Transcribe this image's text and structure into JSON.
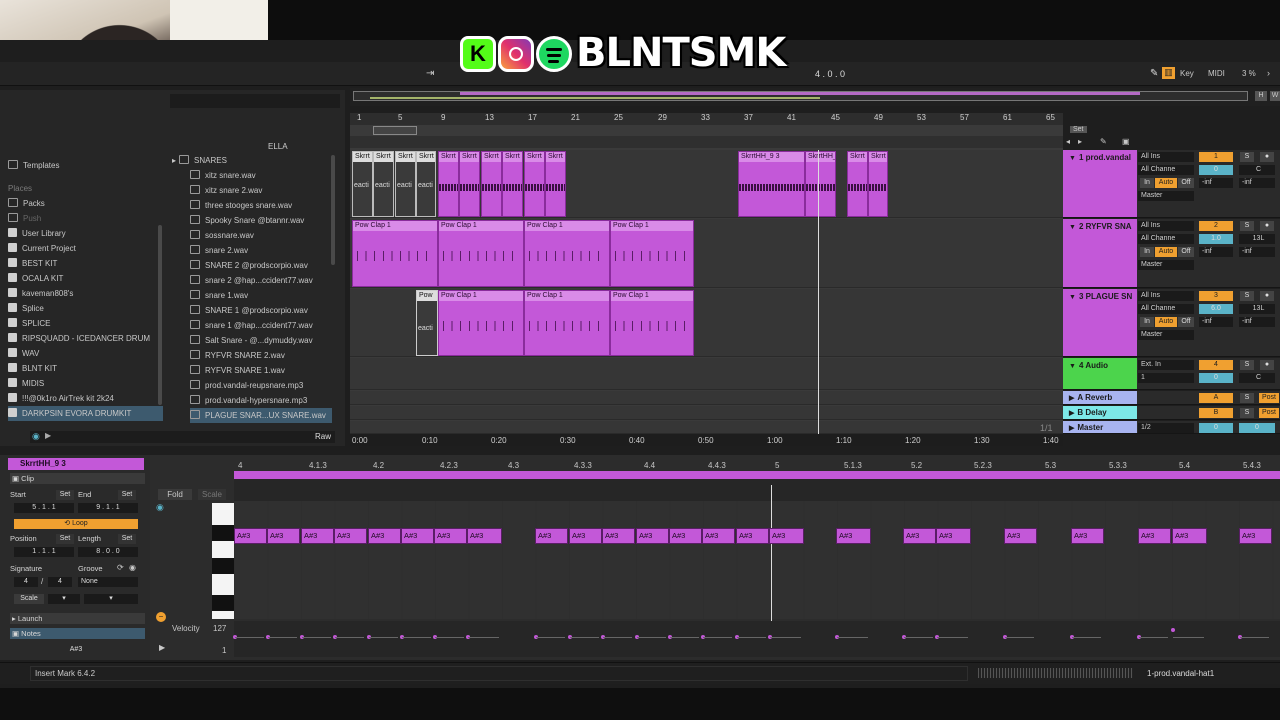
{
  "banner": {
    "name": "BLNTSMK",
    "kick_glyph": "K"
  },
  "toolbar": {
    "position": "4 . 0 . 0",
    "key": "Key",
    "midi": "MIDI",
    "cpu": "3 %",
    "overview_h": "H",
    "overview_w": "W"
  },
  "browser": {
    "partial_text": "ELLA",
    "left_items": [
      "Templates"
    ],
    "places_label": "Places",
    "places": [
      "Packs",
      "Push",
      "User Library",
      "Current Project",
      "BEST KIT",
      "OCALA KIT",
      "kaveman808's",
      "Splice",
      "SPLICE",
      "RIPSQUADD - ICEDANCER DRUM",
      "WAV",
      "BLNT KIT",
      "MIDIS",
      "!!!@0k1ro AirTrek kit 2k24",
      "DARKPSIN EVORA DRUMKIT"
    ],
    "folder": "SNARES",
    "files": [
      "xitz snare.wav",
      "xitz snare 2.wav",
      "three stooges snare.wav",
      "Spooky Snare @btannr.wav",
      "sossnare.wav",
      "snare 2.wav",
      "SNARE 2 @prodscorpio.wav",
      "snare 2 @hap...ccident77.wav",
      "snare 1.wav",
      "SNARE 1 @prodscorpio.wav",
      "snare 1 @hap...ccident77.wav",
      "Salt Snare - @...dymuddy.wav",
      "RYFVR SNARE 2.wav",
      "RYFVR SNARE 1.wav",
      "prod.vandal-reupsnare.mp3",
      "prod.vandal-hypersnare.mp3",
      "PLAGUE SNAR...UX SNARE.wav"
    ],
    "raw": "Raw"
  },
  "arrangement": {
    "bars": [
      "1",
      "5",
      "9",
      "13",
      "17",
      "21",
      "25",
      "29",
      "33",
      "37",
      "41",
      "45",
      "49",
      "53",
      "57",
      "61",
      "65"
    ],
    "set_label": "Set",
    "times": [
      "0:00",
      "0:10",
      "0:20",
      "0:30",
      "0:40",
      "0:50",
      "1:00",
      "1:10",
      "1:20",
      "1:30",
      "1:40"
    ],
    "fraction": "1/1",
    "track1_clips": [
      "Skrrt",
      "Skrrt",
      "Skrrt",
      "Skrrt",
      "Skrrt",
      "Skrrt",
      "Skrrt",
      "Skrrt",
      "Skrrt",
      "Skrrt",
      "SkrrtHH_9 3",
      "SkrrtHH_9",
      "Skrrt",
      "Skrrt"
    ],
    "track1_sub": "eacti",
    "track2_clips": [
      "Pow Clap 1",
      "Pow Clap 1",
      "Pow Clap 1",
      "Pow Clap 1"
    ],
    "track3_clips": [
      "Pow",
      "Pow Clap 1",
      "Pow Clap 1",
      "Pow Clap 1"
    ],
    "track3_sub": "eacti"
  },
  "mixer": {
    "tracks": [
      {
        "name": "1 prod.vandal",
        "input": "All Ins",
        "channel": "All Channe",
        "in": "In",
        "auto": "Auto",
        "off": "Off",
        "out": "Master",
        "num": "1",
        "s": "S",
        "vol": "0",
        "pan": "C",
        "m1": "-inf",
        "m2": "-inf",
        "color": "#c358d8"
      },
      {
        "name": "2 RYFVR SNA",
        "input": "All Ins",
        "channel": "All Channe",
        "in": "In",
        "auto": "Auto",
        "off": "Off",
        "out": "Master",
        "num": "2",
        "s": "S",
        "vol": "1.0",
        "pan": "13L",
        "m1": "-inf",
        "m2": "-inf",
        "color": "#c358d8"
      },
      {
        "name": "3 PLAGUE SN",
        "input": "All Ins",
        "channel": "All Channe",
        "in": "In",
        "auto": "Auto",
        "off": "Off",
        "out": "Master",
        "num": "3",
        "s": "S",
        "vol": "6.0",
        "pan": "13L",
        "m1": "-inf",
        "m2": "-inf",
        "color": "#c358d8"
      },
      {
        "name": "4 Audio",
        "input": "Ext. In",
        "channel": "1",
        "out": "",
        "num": "4",
        "s": "S",
        "vol": "0",
        "pan": "C",
        "color": "#4cd44c"
      }
    ],
    "returns": [
      {
        "name": "A Reverb",
        "letter": "A",
        "s": "S",
        "post": "Post",
        "color": "#a8b4f0"
      },
      {
        "name": "B Delay",
        "letter": "B",
        "s": "S",
        "post": "Post",
        "color": "#7de8e8"
      }
    ],
    "master": {
      "name": "Master",
      "input": "1/2",
      "vol": "0",
      "pan": "0",
      "color": "#a8b4f0"
    }
  },
  "clip_view": {
    "clip_name": "SkrrtHH_9 3",
    "clip_label": "Clip",
    "start_label": "Start",
    "set": "Set",
    "end_label": "End",
    "start_val": [
      "5",
      "1",
      "1"
    ],
    "end_val": [
      "9",
      "1",
      "1"
    ],
    "loop": "Loop",
    "position_label": "Position",
    "length_label": "Length",
    "position_val": [
      "1",
      "1",
      "1"
    ],
    "length_val": [
      "8",
      "0",
      "0"
    ],
    "signature_label": "Signature",
    "groove_label": "Groove",
    "sig_num": "4",
    "sig_den": "4",
    "groove_val": "None",
    "scale_label": "Scale",
    "launch_label": "Launch",
    "notes_label": "Notes",
    "note_val": "A#3"
  },
  "piano_roll": {
    "fold": "Fold",
    "scale": "Scale",
    "ruler": [
      "4",
      "4.1.3",
      "4.2",
      "4.2.3",
      "4.3",
      "4.3.3",
      "4.4",
      "4.4.3",
      "5",
      "5.1.3",
      "5.2",
      "5.2.3",
      "5.3",
      "5.3.3",
      "5.4",
      "5.4.3"
    ],
    "note_label": "A#3",
    "velocity_label": "Velocity",
    "vel_max": "127",
    "vel_min": "1"
  },
  "status": {
    "text": "Insert Mark 6.4.2",
    "track": "1-prod.vandal-hat1"
  }
}
